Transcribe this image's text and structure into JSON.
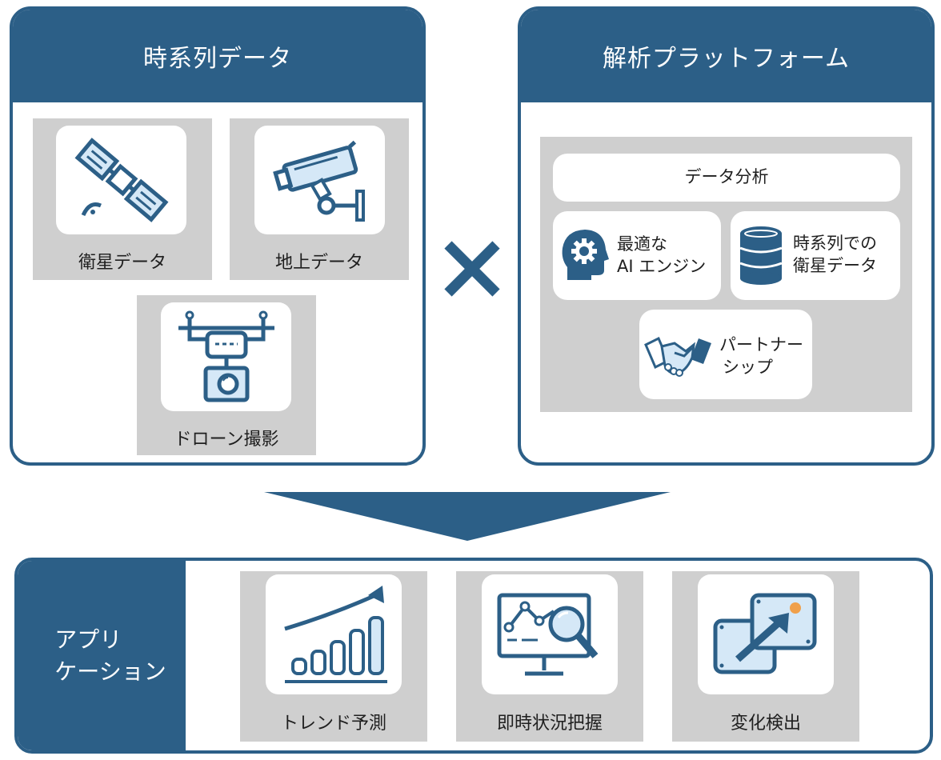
{
  "timeseries": {
    "title": "時系列データ",
    "items": [
      {
        "label": "衛星データ",
        "icon": "satellite-icon"
      },
      {
        "label": "地上データ",
        "icon": "cctv-camera-icon"
      },
      {
        "label": "ドローン撮影",
        "icon": "drone-camera-icon"
      }
    ]
  },
  "operator": {
    "icon": "multiply-icon"
  },
  "platform": {
    "title": "解析プラットフォーム",
    "analysis": "データ分析",
    "ai_line1": "最適な",
    "ai_line2": "AI エンジン",
    "db_line1": "時系列での",
    "db_line2": "衛星データ",
    "partner_line1": "パートナー",
    "partner_line2": "シップ",
    "icons": [
      "ai-head-gear-icon",
      "database-icon",
      "handshake-icon"
    ]
  },
  "flow": {
    "icon": "down-arrow-icon"
  },
  "applications": {
    "title": "アプリ\nケーション",
    "items": [
      {
        "label": "トレンド予測",
        "icon": "trend-chart-icon"
      },
      {
        "label": "即時状況把握",
        "icon": "monitor-search-icon"
      },
      {
        "label": "変化検出",
        "icon": "change-detection-icon"
      }
    ]
  },
  "colors": {
    "primary": "#2c5f87",
    "light_blue": "#d5e8f7",
    "gray": "#cfcfcf",
    "accent": "#f0a04b"
  }
}
